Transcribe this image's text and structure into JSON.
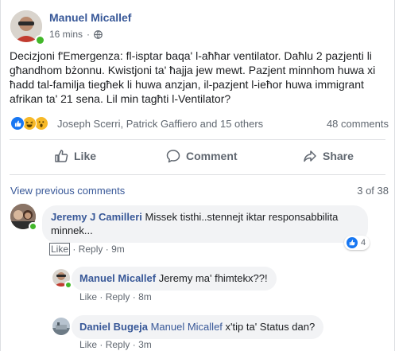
{
  "post": {
    "author": "Manuel Micallef",
    "time": "16 mins",
    "privacy_icon": "globe-icon",
    "text": "Decizjoni f'Emergenza: fl-isptar baqa' l-aħħar ventilator. Daħlu 2 pazjenti li għandhom bżonnu. Kwistjoni ta' ħajja jew mewt. Pazjent minnhom huwa xi ħadd tal-familja tiegħek li huwa anzjan, il-pazjent l-ieħor huwa immigrant afrikan ta' 21 sena. Lil min tagħti l-Ventilator?"
  },
  "reactions": {
    "icons": [
      "like-icon",
      "haha-icon",
      "wow-icon"
    ],
    "names": "Joseph Scerri, Patrick Gaffiero and 15 others",
    "comments_count": "48 comments"
  },
  "actions": {
    "like": "Like",
    "comment": "Comment",
    "share": "Share"
  },
  "comments_section": {
    "view_previous": "View previous comments",
    "position": "3 of 38"
  },
  "comments": [
    {
      "author": "Jeremy J Camilleri",
      "text": "Missek tisthi..stennejt iktar responsabbilita minnek...",
      "like": "Like",
      "reply": "Reply",
      "time": "9m",
      "reaction_count": "4"
    },
    {
      "author": "Manuel Micallef",
      "text": "Jeremy ma' fhimtekx??!",
      "like": "Like",
      "reply": "Reply",
      "time": "8m"
    },
    {
      "author": "Daniel Bugeja",
      "tag": "Manuel Micallef",
      "text": "x'tip ta' Status dan?",
      "like": "Like",
      "reply": "Reply",
      "time": "3m"
    }
  ],
  "colors": {
    "link_blue": "#385898",
    "muted": "#606770",
    "bubble": "#f2f3f5",
    "like_blue": "#1877f2",
    "online_green": "#42b72a"
  }
}
